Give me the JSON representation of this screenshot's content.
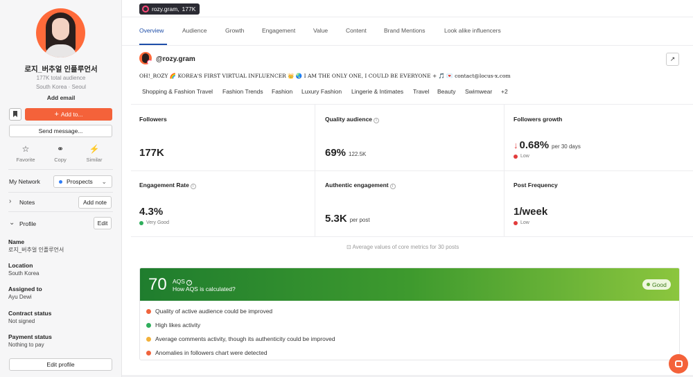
{
  "sidebar": {
    "name": "로지_버추얼 인플루언서",
    "audience": "177K total audience",
    "location": "South Korea · Seoul",
    "add_email": "Add email",
    "add_to_label": "Add to...",
    "send_message_label": "Send message...",
    "quick_actions": [
      {
        "label": "Favorite",
        "icon": "star-icon"
      },
      {
        "label": "Copy",
        "icon": "link-icon"
      },
      {
        "label": "Similar",
        "icon": "magic-wand-icon"
      }
    ],
    "my_network_label": "My Network",
    "network_value": "Prospects",
    "notes_label": "Notes",
    "add_note_label": "Add note",
    "profile_label": "Profile",
    "edit_label": "Edit",
    "fields": [
      {
        "label": "Name",
        "value": "로지_버추얼 인플루언서"
      },
      {
        "label": "Location",
        "value": "South Korea"
      },
      {
        "label": "Assigned to",
        "value": "Ayu Dewi"
      },
      {
        "label": "Contract status",
        "value": "Not signed"
      },
      {
        "label": "Payment status",
        "value": "Nothing to pay"
      }
    ],
    "edit_profile_label": "Edit profile"
  },
  "header": {
    "badge_handle": "rozy.gram,",
    "badge_count": "177K"
  },
  "tabs": [
    {
      "label": "Overview",
      "active": true
    },
    {
      "label": "Audience"
    },
    {
      "label": "Growth"
    },
    {
      "label": "Engagement"
    },
    {
      "label": "Value"
    },
    {
      "label": "Content"
    },
    {
      "label": "Brand Mentions"
    },
    {
      "label": "Look alike influencers"
    }
  ],
  "profile": {
    "handle": "@rozy.gram",
    "bio": "OH!_ROZY 🌈 KOREA'S FIRST VIRTUAL INFLUENCER 👑 🌏 I AM THE ONLY ONE, I COULD BE EVERYONE + 🎵 💌 contact@locus-x.com",
    "tags": [
      "Shopping & Fashion Travel",
      "Fashion Trends",
      "Fashion",
      "Luxury Fashion",
      "Lingerie & Intimates",
      "Travel",
      "Beauty",
      "Swimwear",
      "+2"
    ]
  },
  "metrics": {
    "followers": {
      "label": "Followers",
      "value": "177K"
    },
    "quality_audience": {
      "label": "Quality audience",
      "value": "69%",
      "sub": "122.5K"
    },
    "followers_growth": {
      "label": "Followers growth",
      "value": "0.68%",
      "sub": "per 30 days",
      "status": "Low"
    },
    "engagement_rate": {
      "label": "Engagement Rate",
      "value": "4.3%",
      "status": "Very Good"
    },
    "authentic_engagement": {
      "label": "Authentic engagement",
      "value": "5.3K",
      "sub": "per post"
    },
    "post_frequency": {
      "label": "Post Frequency",
      "value": "1/week",
      "status": "Low"
    },
    "note": "Average values of core metrics for 30 posts"
  },
  "aqs": {
    "score": "70",
    "title": "AQS",
    "link": "How AQS is calculated?",
    "badge": "Good",
    "items": [
      {
        "text": "Quality of active audience could be improved",
        "color": "#f0643c"
      },
      {
        "text": "High likes activity",
        "color": "#2fae5c"
      },
      {
        "text": "Average comments activity, though its authenticity could be improved",
        "color": "#f2b13a"
      },
      {
        "text": "Anomalies in followers chart were detected",
        "color": "#f0643c"
      }
    ]
  },
  "colors": {
    "accent": "#f4623a",
    "active_tab": "#1d4da8",
    "status_red": "#e23c3c",
    "status_green": "#2fae5c"
  }
}
